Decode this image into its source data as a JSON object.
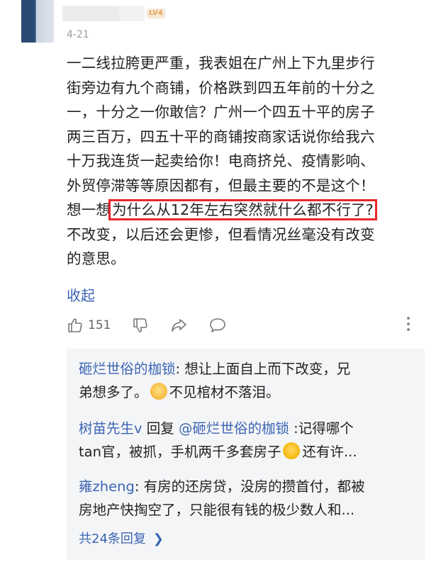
{
  "comment": {
    "badge": "LV4",
    "date": "4-21",
    "lines_before": [
      "一二线拉胯更严重，我表姐在广州上下九里步行",
      "街旁边有九个商铺，价格跌到四五年前的十分之",
      "一，十分之一你敢信？广州一个四五十平的房子",
      "两三百万，四五十平的商铺按商家话说你给我六",
      "十万我连货一起卖给你！电商挤兑、疫情影响、",
      "外贸停滞等等原因都有，但最主要的不是这个！"
    ],
    "highlight_prefix": "想一想",
    "highlight_text": "为什么从12年左右突然就什么都不行了?",
    "lines_after": [
      "不改变，以后还会更惨，但看情况丝毫没有改变",
      "的意思。"
    ],
    "collapse_label": "收起",
    "like_count": "151"
  },
  "replies": [
    {
      "line1_name": "砸烂世俗的枷锁",
      "line1_text": ": 想让上面自上而下改变，兄",
      "line2_pre": "弟想多了。",
      "emoji": "dog-emoji",
      "line2_post": "不见棺材不落泪。"
    },
    {
      "line1_name": "树苗先生v",
      "line1_mid": " 回复 ",
      "line1_target": "@砸烂世俗的枷锁",
      "line1_text": " :记得哪个",
      "line2_pre": "tan官，被抓，手机两千多套房子",
      "emoji": "thinking-emoji",
      "line2_post": "还有许..."
    },
    {
      "line1_name": "雍zheng",
      "line1_text": ": 有房的还房贷，没房的攒首付，都被",
      "line2_pre": "房地产快掏空了，只能很有钱的极少数人和..."
    }
  ],
  "more_replies_label": "共24条回复",
  "colors": {
    "link_blue": "#3b64b4",
    "highlight_red": "#e8262b",
    "reply_bg": "#f4f5f7"
  }
}
